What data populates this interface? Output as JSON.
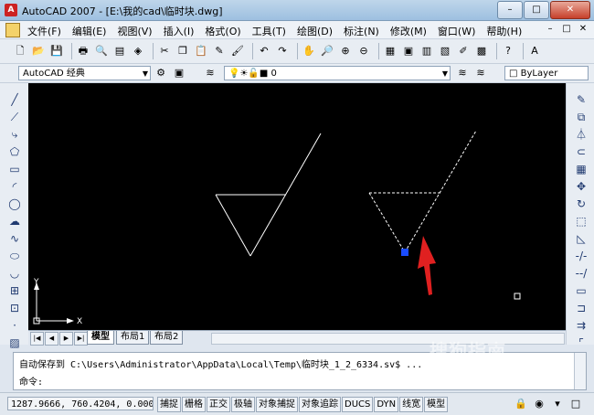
{
  "window": {
    "title": "AutoCAD 2007 - [E:\\我的cad\\临时块.dwg]",
    "app_icon": "A",
    "buttons": [
      "–",
      "□",
      "✕"
    ]
  },
  "menu": {
    "items": [
      "文件(F)",
      "编辑(E)",
      "视图(V)",
      "插入(I)",
      "格式(O)",
      "工具(T)",
      "绘图(D)",
      "标注(N)",
      "修改(M)",
      "窗口(W)",
      "帮助(H)"
    ],
    "controls": [
      "–",
      "□",
      "✕"
    ]
  },
  "toolbar_standard": {
    "icons": [
      "new-icon",
      "open-icon",
      "save-icon",
      "print-icon",
      "preview-icon",
      "publish-icon",
      "plot-icon",
      "cut-icon",
      "copy-icon",
      "paste-icon",
      "brush-icon",
      "match-icon",
      "undo-icon",
      "redo-icon",
      "pan-icon",
      "zoom-realtime-icon",
      "zoom-window-icon",
      "zoom-previous-icon",
      "properties-icon",
      "designcenter-icon",
      "toolpalettes-icon",
      "sheetset-icon",
      "markup-icon",
      "calculator-icon",
      "help-icon",
      "text-style-icon"
    ]
  },
  "toolbar_workspace": {
    "workspace_value": "AutoCAD 经典",
    "layer_value": "0",
    "color_value": "ByLayer"
  },
  "draw_toolbar": {
    "icons": [
      "line-icon",
      "ray-icon",
      "polyline-icon",
      "polygon-icon",
      "rectangle-icon",
      "arc-icon",
      "circle-icon",
      "revcloud-icon",
      "spline-icon",
      "ellipse-icon",
      "ellipse-arc-icon",
      "insert-block-icon",
      "make-block-icon",
      "point-icon",
      "hatch-icon"
    ]
  },
  "modify_toolbar": {
    "icons": [
      "erase-icon",
      "copy-object-icon",
      "mirror-icon",
      "offset-icon",
      "array-icon",
      "move-icon",
      "rotate-icon",
      "scale-icon",
      "stretch-icon",
      "trim-icon",
      "extend-icon",
      "break-icon",
      "join-icon",
      "chamfer-icon",
      "fillet-icon"
    ]
  },
  "canvas": {
    "ucs_x": "X",
    "ucs_y": "Y",
    "background": "#000000",
    "arrow_color": "#e02020",
    "grip_color": "#1a4cff"
  },
  "tabs": {
    "items": [
      "模型",
      "布局1",
      "布局2"
    ],
    "active": "模型"
  },
  "command": {
    "line1": "自动保存到 C:\\Users\\Administrator\\AppData\\Local\\Temp\\临时块_1_2_6334.sv$ ...",
    "line2": "命令:"
  },
  "status": {
    "coords": "1287.9666, 760.4204, 0.0000",
    "buttons": [
      "捕捉",
      "栅格",
      "正交",
      "极轴",
      "对象捕捉",
      "对象追踪",
      "DUCS",
      "DYN",
      "线宽",
      "模型"
    ]
  },
  "watermark": "搜狗指南"
}
